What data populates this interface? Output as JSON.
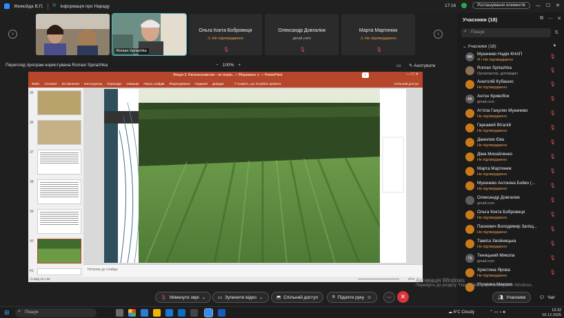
{
  "titlebar": {
    "app_name": "Жемойда В.П.",
    "meeting_info": "Інформація про Нараду",
    "time": "17:16",
    "floating_elements": "Розташування елементів"
  },
  "gallery": {
    "tiles": [
      {
        "name": "",
        "status": ""
      },
      {
        "name": "Roman Spriazhka",
        "status": ""
      },
      {
        "name": "Ольга Кокта Бобровиця",
        "status": "Не підтверджено"
      },
      {
        "name": "Олександр Довгалюк",
        "status": "gmail.com"
      },
      {
        "name": "Марта Мартинюк",
        "status": "Не підтверджено"
      }
    ]
  },
  "share": {
    "title": "Перегляд програм користувача Roman Spriazhka",
    "zoom": "100%",
    "annotate": "Анотувати"
  },
  "ppt": {
    "window_title": "Лекція 3. Насіннєзнавство - як теорія... • Збережено ∨ — PowerPoint",
    "tabs": [
      "Файл",
      "Основне",
      "Вставлення",
      "Конструктор",
      "Переходи",
      "Анімація",
      "Показ слайдів",
      "Рецензування",
      "Подання",
      "Довідка"
    ],
    "search": "Скажіть, що потрібно зробити",
    "share_btn": "Спільний доступ",
    "thumb_numbers": [
      "35",
      "36",
      "37",
      "38",
      "39",
      "40",
      "41"
    ],
    "notes": "Нотатки до слайда",
    "status": "Слайд 40 з 95",
    "zoom": "87%"
  },
  "panel": {
    "title": "Учасники (18)",
    "search_placeholder": "Пошук",
    "section": "Учасники (18)",
    "participants": [
      {
        "initials": "МК",
        "name": "Мукачево Надія КНАП",
        "sub": "Я • Не підтверджено",
        "gray": true
      },
      {
        "initials": "",
        "name": "Roman Spriazhka",
        "sub": "Організатор, доповідач",
        "gray": false,
        "ok": true
      },
      {
        "initials": "",
        "name": "Анатолій Кубашко",
        "sub": "Не підтверджено",
        "gray": false
      },
      {
        "initials": "АК",
        "name": "Антон Кривобок",
        "sub": "gmail.com",
        "gray": true,
        "ok": true
      },
      {
        "initials": "",
        "name": "Аттіла Ганулях Мукачево",
        "sub": "Не підтверджено",
        "gray": false
      },
      {
        "initials": "",
        "name": "Гаркавий Віталій",
        "sub": "Не підтверджено",
        "gray": false
      },
      {
        "initials": "",
        "name": "Данилюк Єва",
        "sub": "Не підтверджено",
        "gray": false
      },
      {
        "initials": "",
        "name": "Діма Михайленко",
        "sub": "Не підтверджено",
        "gray": false
      },
      {
        "initials": "",
        "name": "Марта Мартинюк",
        "sub": "Не підтверджено",
        "gray": false
      },
      {
        "initials": "",
        "name": "Мукачево Антоніна Бойко (...",
        "sub": "Не підтверджено",
        "gray": false
      },
      {
        "initials": "",
        "name": "Олександр Довгалюк",
        "sub": "gmail.com",
        "gray": true,
        "ok": true
      },
      {
        "initials": "",
        "name": "Ольга Кокта Бобровиця",
        "sub": "Не підтверджено",
        "gray": false
      },
      {
        "initials": "",
        "name": "Паскевич Володимир Заліщ...",
        "sub": "Не підтверджено",
        "gray": false
      },
      {
        "initials": "",
        "name": "Таміла Хвойницька",
        "sub": "Не підтверджено",
        "gray": false
      },
      {
        "initials": "ТК",
        "name": "Теницький Микола",
        "sub": "gmail.com",
        "gray": true,
        "ok": true
      },
      {
        "initials": "",
        "name": "Христина Ярова",
        "sub": "Не підтверджено",
        "gray": false
      },
      {
        "initials": "",
        "name": "Юрченко Максим",
        "sub": "",
        "gray": false
      }
    ]
  },
  "controls": {
    "unmute": "Увімкнути звук",
    "stop_video": "Зупинити відео",
    "share": "Спільний доступ",
    "raise_hand": "Підняти руку",
    "participants": "Учасники",
    "chat": "Чат"
  },
  "watermark": {
    "line1": "Активація Windows",
    "line2": "Перейдіть до розділу \"Настройки\", щоб активувати Windows."
  },
  "taskbar": {
    "search": "Пошук",
    "weather": "6°C  Cloudy",
    "time": "13:32",
    "date": "02.12.2025"
  },
  "colors": {
    "accent": "#3fc0c9",
    "ppt_red": "#b7472a",
    "unconfirmed": "#f0a050",
    "leave": "#d9343a"
  }
}
